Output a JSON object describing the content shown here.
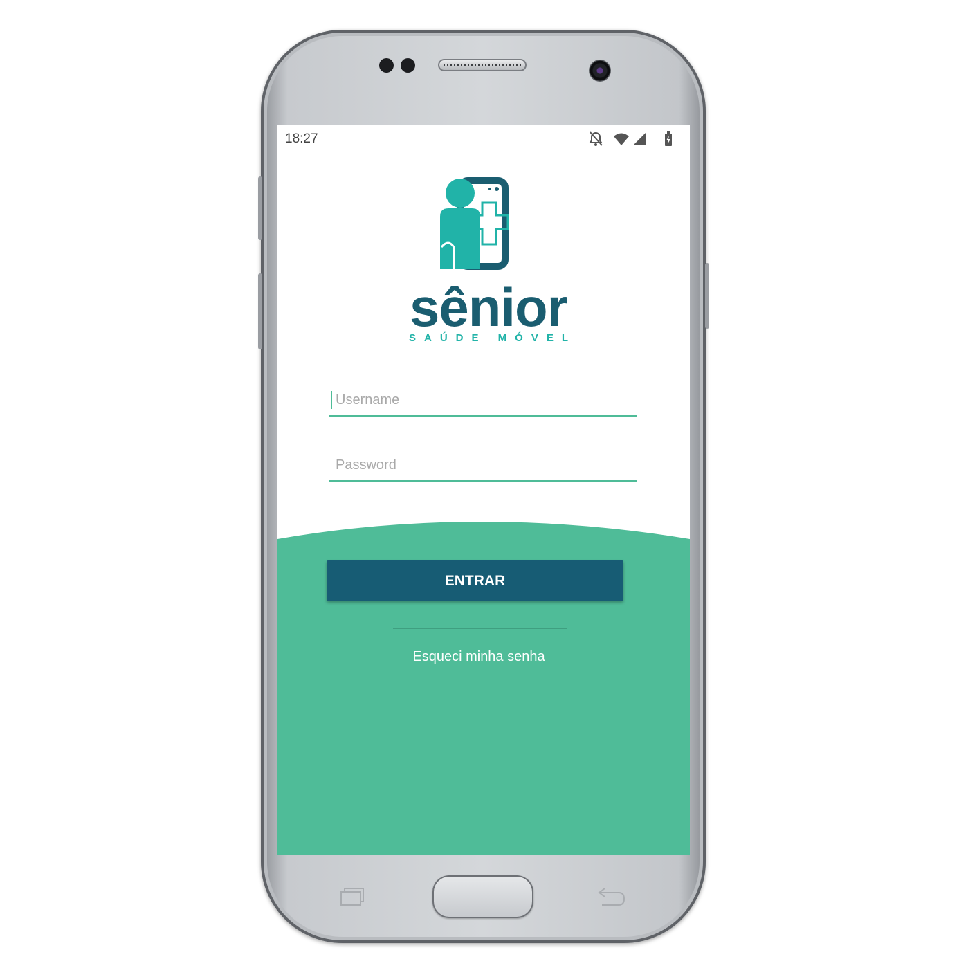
{
  "status_bar": {
    "time": "18:27",
    "icons": [
      "notifications-off-icon",
      "wifi-icon",
      "signal-icon",
      "battery-charging-icon"
    ]
  },
  "logo": {
    "name": "sênior",
    "tagline": "SAÚDE MÓVEL"
  },
  "form": {
    "username_placeholder": "Username",
    "password_placeholder": "Password",
    "submit_label": "ENTRAR",
    "forgot_label": "Esqueci minha senha"
  },
  "device_nav": [
    "recent-apps-icon",
    "home-button",
    "back-icon"
  ],
  "colors": {
    "primary": "#175c74",
    "accent": "#4fbc98",
    "logo_teal": "#21b3a8",
    "logo_dark": "#1a5d70"
  }
}
